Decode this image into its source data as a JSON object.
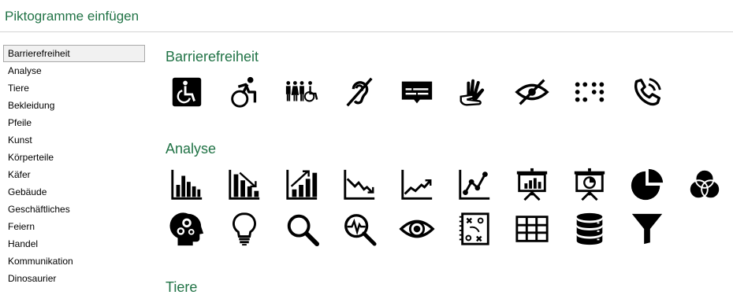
{
  "dialog": {
    "title": "Piktogramme einfügen"
  },
  "sidebar": {
    "items": [
      {
        "label": "Barrierefreiheit",
        "selected": true
      },
      {
        "label": "Analyse"
      },
      {
        "label": "Tiere"
      },
      {
        "label": "Bekleidung"
      },
      {
        "label": "Pfeile"
      },
      {
        "label": "Kunst"
      },
      {
        "label": "Körperteile"
      },
      {
        "label": "Käfer"
      },
      {
        "label": "Gebäude"
      },
      {
        "label": "Geschäftliches"
      },
      {
        "label": "Feiern"
      },
      {
        "label": "Handel"
      },
      {
        "label": "Kommunikation"
      },
      {
        "label": "Dinosaurier"
      }
    ]
  },
  "categories": [
    {
      "title": "Barrierefreiheit",
      "icons": [
        "accessible-square-icon",
        "active-wheelchair-icon",
        "family-wheelchair-icon",
        "hearing-impaired-icon",
        "closed-captioning-icon",
        "sign-language-icon",
        "visually-impaired-icon",
        "braille-icon",
        "volume-telephone-icon"
      ]
    },
    {
      "title": "Analyse",
      "icons": [
        "bar-chart-icon",
        "bar-chart-downward-icon",
        "bar-chart-upward-icon",
        "downward-trend-icon",
        "upward-trend-icon",
        "line-chart-icon",
        "presentation-bar-chart-icon",
        "presentation-pie-chart-icon",
        "pie-chart-icon",
        "venn-diagram-icon",
        "head-gears-icon",
        "lightbulb-icon",
        "magnifying-glass-icon",
        "heartbeat-search-icon",
        "eye-icon",
        "strategy-icon",
        "table-icon",
        "database-icon",
        "funnel-icon"
      ]
    },
    {
      "title": "Tiere",
      "icons": []
    }
  ]
}
